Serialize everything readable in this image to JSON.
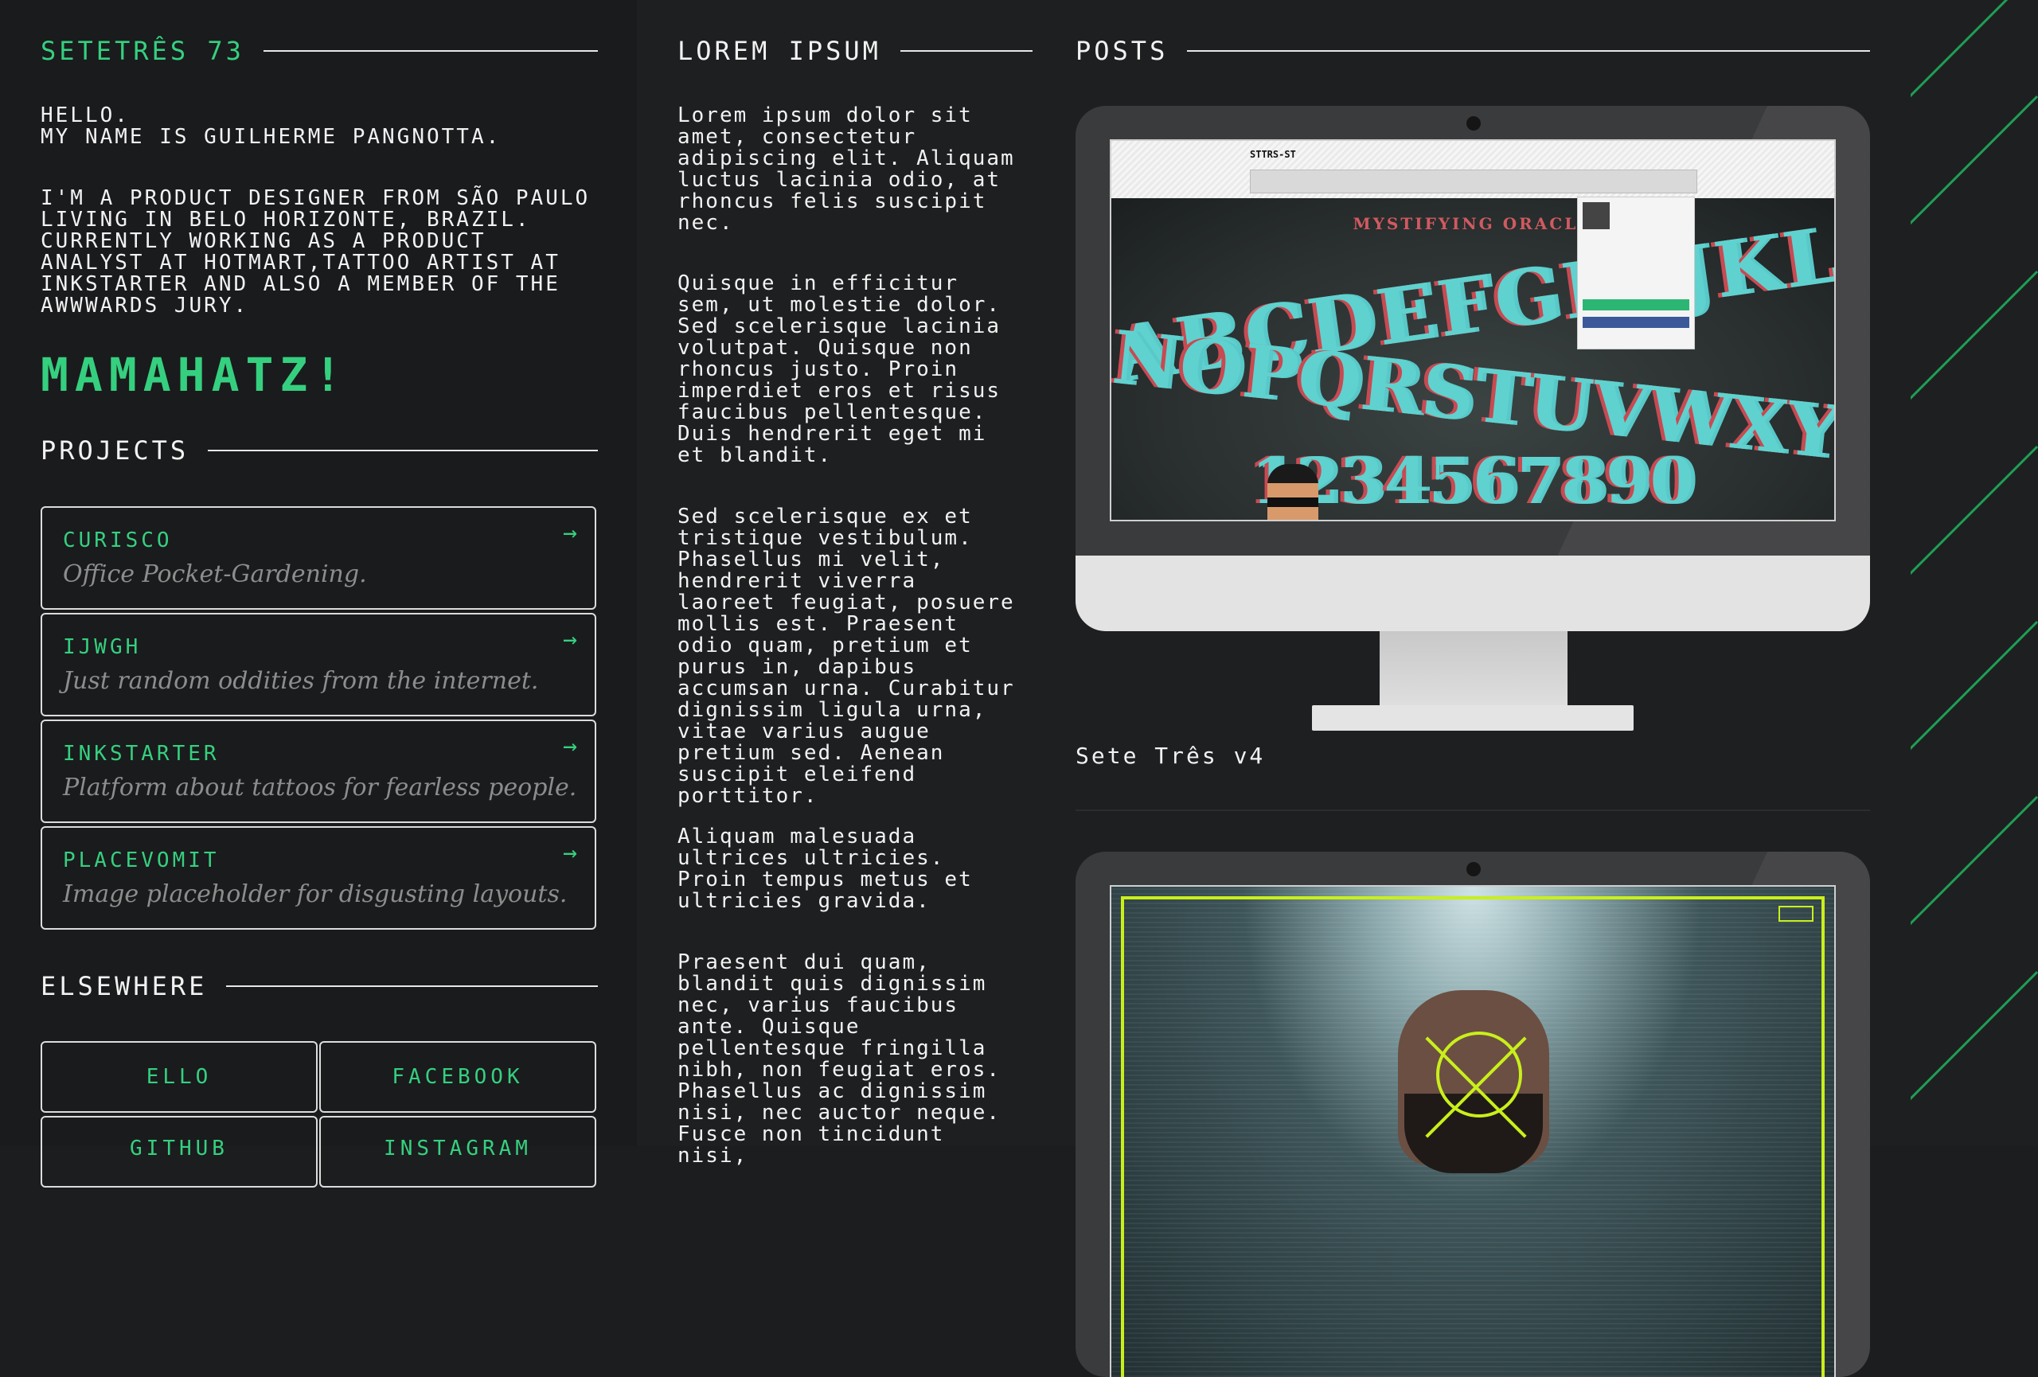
{
  "header": {
    "site_title": "SETETRÊS 73",
    "lorem_title": "LOREM IPSUM",
    "posts_title": "POSTS"
  },
  "bio": {
    "greeting_line1": "HELLO.",
    "greeting_line2": "MY NAME IS GUILHERME PANGNOTTA.",
    "about": "I'M A PRODUCT DESIGNER FROM SÃO PAULO LIVING IN BELO HORIZONTE, BRAZIL. CURRENTLY WORKING AS A PRODUCT ANALYST AT HOTMART,TATTOO ARTIST AT INKSTARTER AND ALSO A MEMBER OF THE AWWWARDS JURY."
  },
  "brand": "MAMAHATZ!",
  "projects": {
    "heading": "PROJECTS",
    "arrow": "→",
    "items": [
      {
        "name": "CURISCO",
        "desc": "Office Pocket-Gardening."
      },
      {
        "name": "IJWGH",
        "desc": "Just random oddities from the internet."
      },
      {
        "name": "INKSTARTER",
        "desc": "Platform about tattoos for fearless people."
      },
      {
        "name": "PLACEVOMIT",
        "desc": "Image placeholder for disgusting layouts."
      }
    ]
  },
  "elsewhere": {
    "heading": "ELSEWHERE",
    "links": [
      "ELLO",
      "FACEBOOK",
      "GITHUB",
      "INSTAGRAM"
    ]
  },
  "lorem": [
    "Lorem ipsum dolor sit amet, consectetur adipiscing elit. Aliquam luctus lacinia odio, at rhoncus felis suscipit nec.",
    "Quisque in efficitur sem, ut molestie dolor. Sed scelerisque lacinia volutpat. Quisque non rhoncus justo. Proin imperdiet eros et risus faucibus pellentesque. Duis hendrerit eget mi et blandit.",
    "Sed scelerisque ex et tristique vestibulum. Phasellus mi velit, hendrerit viverra laoreet feugiat, posuere mollis est. Praesent odio quam, pretium et purus in, dapibus accumsan urna. Curabitur dignissim ligula urna, vitae varius augue pretium sed. Aenean suscipit eleifend porttitor.",
    "Aliquam malesuada ultrices ultricies. Proin tempus metus et ultricies gravida.",
    "Praesent dui quam, blandit quis dignissim nec, varius faucibus ante. Quisque pellentesque fringilla nibh, non feugiat eros. Phasellus ac dignissim nisi, nec auctor neque. Fusce non tincidunt nisi,"
  ],
  "posts": [
    {
      "title": "Sete Três v4",
      "screen": {
        "browser_logo": "STTRS-ST",
        "board_subtitle": "MYSTIFYING ORACLE",
        "board_row1": "ABCDEFGHIJKLM",
        "board_row2": "NOPQRSTUVWXYZ",
        "board_row3": "1234567890"
      }
    },
    {
      "screen": {
        "tag_label": ""
      }
    }
  ],
  "colors": {
    "accent": "#35d07f",
    "background": "#1c1d1f",
    "text": "#f2f2f2",
    "muted": "#8d8d8d",
    "highlight": "#c9ef1b"
  }
}
